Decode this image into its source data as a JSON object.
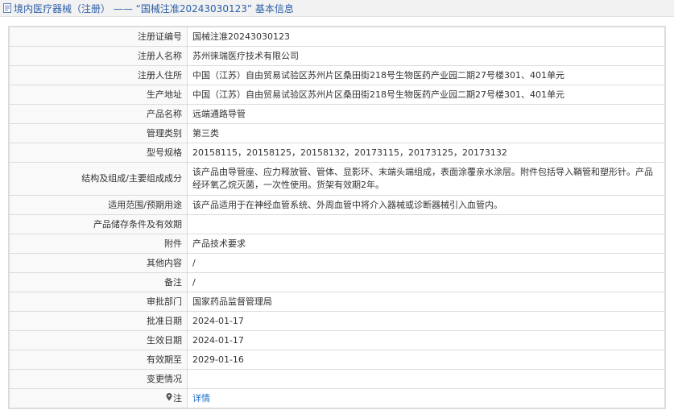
{
  "header": {
    "title_prefix": "境内医疗器械（注册）",
    "title_sep": " —— ",
    "title_link": "“国械注准20243030123”",
    "title_suffix": " 基本信息"
  },
  "rows": [
    {
      "label": "注册证编号",
      "value": "国械注准20243030123"
    },
    {
      "label": "注册人名称",
      "value": "苏州徕瑞医疗技术有限公司"
    },
    {
      "label": "注册人住所",
      "value": "中国（江苏）自由贸易试验区苏州片区桑田街218号生物医药产业园二期27号楼301、401单元"
    },
    {
      "label": "生产地址",
      "value": "中国（江苏）自由贸易试验区苏州片区桑田街218号生物医药产业园二期27号楼301、401单元"
    },
    {
      "label": "产品名称",
      "value": "远端通路导管"
    },
    {
      "label": "管理类别",
      "value": "第三类"
    },
    {
      "label": "型号规格",
      "value": "20158115，20158125，20158132，20173115，20173125，20173132"
    },
    {
      "label": "结构及组成/主要组成成分",
      "value": "该产品由导管座、应力释放管、管体、显影环、末端头端组成，表面涂覆亲水涂层。附件包括导入鞘管和塑形针。产品经环氧乙烷灭菌，一次性使用。货架有效期2年。"
    },
    {
      "label": "适用范围/预期用途",
      "value": "该产品适用于在神经血管系统、外周血管中将介入器械或诊断器械引入血管内。"
    },
    {
      "label": "产品储存条件及有效期",
      "value": ""
    },
    {
      "label": "附件",
      "value": "产品技术要求"
    },
    {
      "label": "其他内容",
      "value": "/"
    },
    {
      "label": "备注",
      "value": "/"
    },
    {
      "label": "审批部门",
      "value": "国家药品监督管理局"
    },
    {
      "label": "批准日期",
      "value": "2024-01-17"
    },
    {
      "label": "生效日期",
      "value": "2024-01-17"
    },
    {
      "label": "有效期至",
      "value": "2029-01-16"
    },
    {
      "label": "变更情况",
      "value": ""
    }
  ],
  "note_row": {
    "label": "注",
    "value": "详情"
  },
  "colors": {
    "link": "#1f6fc5",
    "title": "#2a5ea8"
  }
}
